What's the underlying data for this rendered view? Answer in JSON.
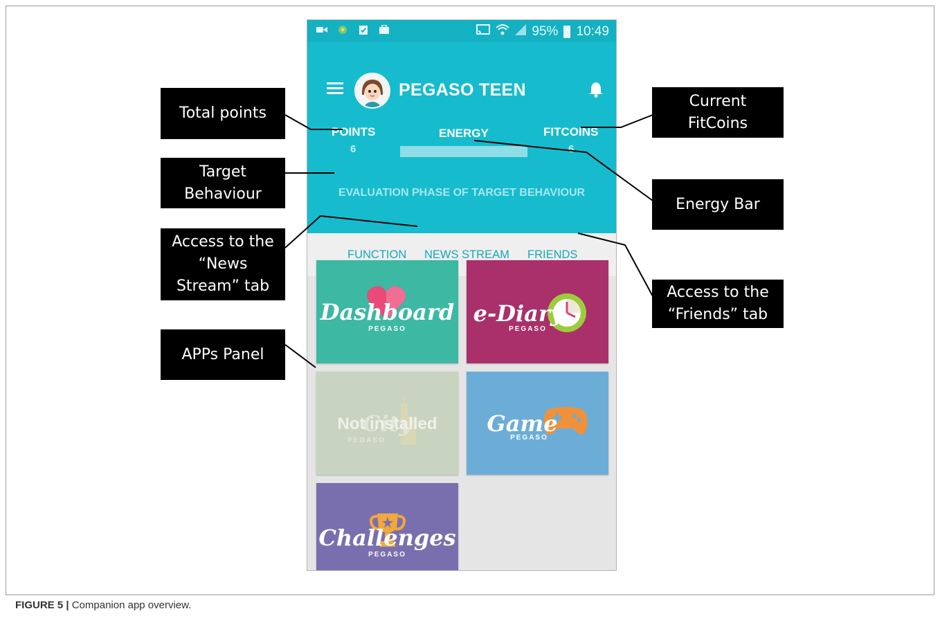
{
  "statusbar": {
    "battery": "95%",
    "time": "10:49"
  },
  "app": {
    "title": "PEGASO TEEN"
  },
  "stats": {
    "points_label": "POINTS",
    "points_value": "6",
    "energy_label": "ENERGY",
    "energy_level": 0.55,
    "fitcoins_label": "FITCOINS",
    "fitcoins_value": "6"
  },
  "target_behaviour": "EVALUATION PHASE OF TARGET BEHAVIOUR",
  "tabs": [
    {
      "label": "FUNCTION",
      "active": true
    },
    {
      "label": "NEWS STREAM",
      "active": false
    },
    {
      "label": "FRIENDS",
      "active": false
    }
  ],
  "apps": [
    {
      "name": "Dashboard",
      "sub": "PEGASO",
      "color": "#3cb8a3"
    },
    {
      "name": "e-Diary",
      "sub": "PEGASO",
      "color": "#a9306a"
    },
    {
      "name": "City",
      "sub": "PEGASO",
      "status": "Not installed",
      "color": "#c8d4c0"
    },
    {
      "name": "Game",
      "sub": "PEGASO",
      "color": "#6cadd8"
    },
    {
      "name": "Challenges",
      "sub": "PEGASO",
      "color": "#7a6fae"
    }
  ],
  "callouts": {
    "total_points": "Total points",
    "current_fitcoins_1": "Current",
    "current_fitcoins_2": "FitCoins",
    "target_behaviour_1": "Target",
    "target_behaviour_2": "Behaviour",
    "energy_bar": "Energy Bar",
    "news_stream_1": "Access to the",
    "news_stream_2": "“News",
    "news_stream_3": "Stream” tab",
    "friends_1": "Access to the",
    "friends_2": "“Friends” tab",
    "apps_panel": "APPs Panel"
  },
  "caption": {
    "label": "FIGURE 5 |",
    "text": " Companion app overview."
  },
  "colors": {
    "primary": "#16bccd",
    "statusbar": "#14b1c2",
    "tab_text": "#17a7b8"
  }
}
